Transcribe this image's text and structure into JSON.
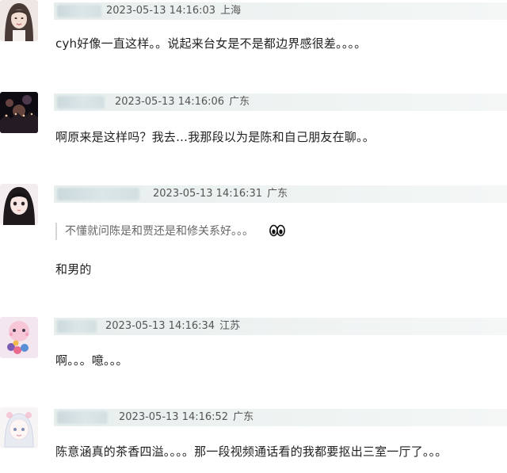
{
  "comments": [
    {
      "timestamp": "2023-05-13 14:16:03",
      "location": "上海",
      "text": "cyh好像一直这样。。说起来台女是不是都边界感很差。。。。"
    },
    {
      "timestamp": "2023-05-13 14:16:06",
      "location": "广东",
      "text": "啊原来是这样吗？我去…我那段以为是陈和自己朋友在聊。。"
    },
    {
      "timestamp": "2023-05-13 14:16:31",
      "location": "广东",
      "quote": "不懂就问陈是和贾还是和修关系好。。。",
      "quote_emoji": "eyes-icon",
      "text": "和男的"
    },
    {
      "timestamp": "2023-05-13 14:16:34",
      "location": "江苏",
      "text": "啊。。。噫。。。"
    },
    {
      "timestamp": "2023-05-13 14:16:52",
      "location": "广东",
      "text": "陈意涵真的茶香四溢。。。。那一段视频通话看的我都要抠出三室一厅了。。。"
    }
  ]
}
